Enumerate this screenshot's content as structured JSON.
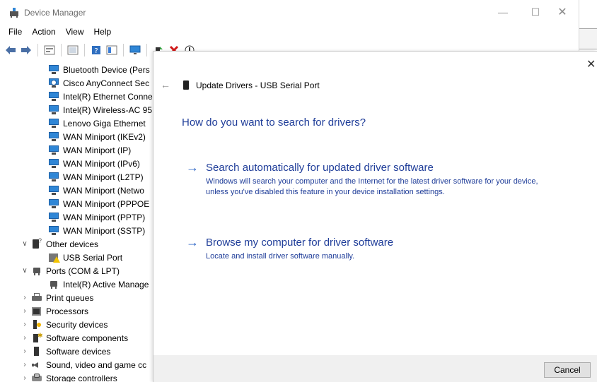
{
  "window": {
    "title": "Device Manager",
    "minimize_glyph": "—",
    "maximize_glyph": "☐",
    "close_glyph": "✕"
  },
  "menu": [
    "File",
    "Action",
    "View",
    "Help"
  ],
  "toolbar_icons": [
    "back-icon",
    "forward-icon",
    "properties-icon",
    "show-hidden-icon",
    "help-icon",
    "view-icon",
    "monitor-icon",
    "update-driver-icon",
    "uninstall-icon",
    "scan-icon"
  ],
  "tree": [
    {
      "label": "Bluetooth Device (Pers",
      "icon": "network-adapter-icon",
      "level": 2
    },
    {
      "label": "Cisco AnyConnect Sec",
      "icon": "cisco-adapter-icon",
      "level": 2
    },
    {
      "label": "Intel(R) Ethernet Conne",
      "icon": "network-adapter-icon",
      "level": 2
    },
    {
      "label": "Intel(R) Wireless-AC 95",
      "icon": "network-adapter-icon",
      "level": 2
    },
    {
      "label": "Lenovo Giga Ethernet",
      "icon": "network-adapter-icon",
      "level": 2
    },
    {
      "label": "WAN Miniport (IKEv2)",
      "icon": "network-adapter-icon",
      "level": 2
    },
    {
      "label": "WAN Miniport (IP)",
      "icon": "network-adapter-icon",
      "level": 2
    },
    {
      "label": "WAN Miniport (IPv6)",
      "icon": "network-adapter-icon",
      "level": 2
    },
    {
      "label": "WAN Miniport (L2TP)",
      "icon": "network-adapter-icon",
      "level": 2
    },
    {
      "label": "WAN Miniport (Netwo",
      "icon": "network-adapter-icon",
      "level": 2
    },
    {
      "label": "WAN Miniport (PPPOE",
      "icon": "network-adapter-icon",
      "level": 2
    },
    {
      "label": "WAN Miniport (PPTP)",
      "icon": "network-adapter-icon",
      "level": 2
    },
    {
      "label": "WAN Miniport (SSTP)",
      "icon": "network-adapter-icon",
      "level": 2
    },
    {
      "label": "Other devices",
      "icon": "other-devices-icon",
      "level": 1,
      "expanded": true
    },
    {
      "label": "USB Serial Port",
      "icon": "usb-warning-icon",
      "level": 2
    },
    {
      "label": "Ports (COM & LPT)",
      "icon": "port-icon",
      "level": 1,
      "expanded": true
    },
    {
      "label": "Intel(R) Active Manage",
      "icon": "port-icon",
      "level": 2
    },
    {
      "label": "Print queues",
      "icon": "printer-icon",
      "level": 1,
      "expanded": false
    },
    {
      "label": "Processors",
      "icon": "processor-icon",
      "level": 1,
      "expanded": false
    },
    {
      "label": "Security devices",
      "icon": "security-icon",
      "level": 1,
      "expanded": false
    },
    {
      "label": "Software components",
      "icon": "software-component-icon",
      "level": 1,
      "expanded": false
    },
    {
      "label": "Software devices",
      "icon": "software-device-icon",
      "level": 1,
      "expanded": false
    },
    {
      "label": "Sound, video and game cc",
      "icon": "speaker-icon",
      "level": 1,
      "expanded": false
    },
    {
      "label": "Storage controllers",
      "icon": "storage-icon",
      "level": 1,
      "expanded": false
    }
  ],
  "dialog": {
    "title": "Update Drivers - USB Serial Port",
    "back_glyph": "←",
    "close_glyph": "✕",
    "question": "How do you want to search for drivers?",
    "options": [
      {
        "arrow": "→",
        "title": "Search automatically for updated driver software",
        "description": "Windows will search your computer and the Internet for the latest driver software for your device, unless you've disabled this feature in your device installation settings."
      },
      {
        "arrow": "→",
        "title": "Browse my computer for driver software",
        "description": "Locate and install driver software manually."
      }
    ],
    "cancel_label": "Cancel"
  },
  "colors": {
    "link_blue": "#1f3d99",
    "arrow_blue": "#2a63c5",
    "footer_bg": "#f0f0f0"
  }
}
